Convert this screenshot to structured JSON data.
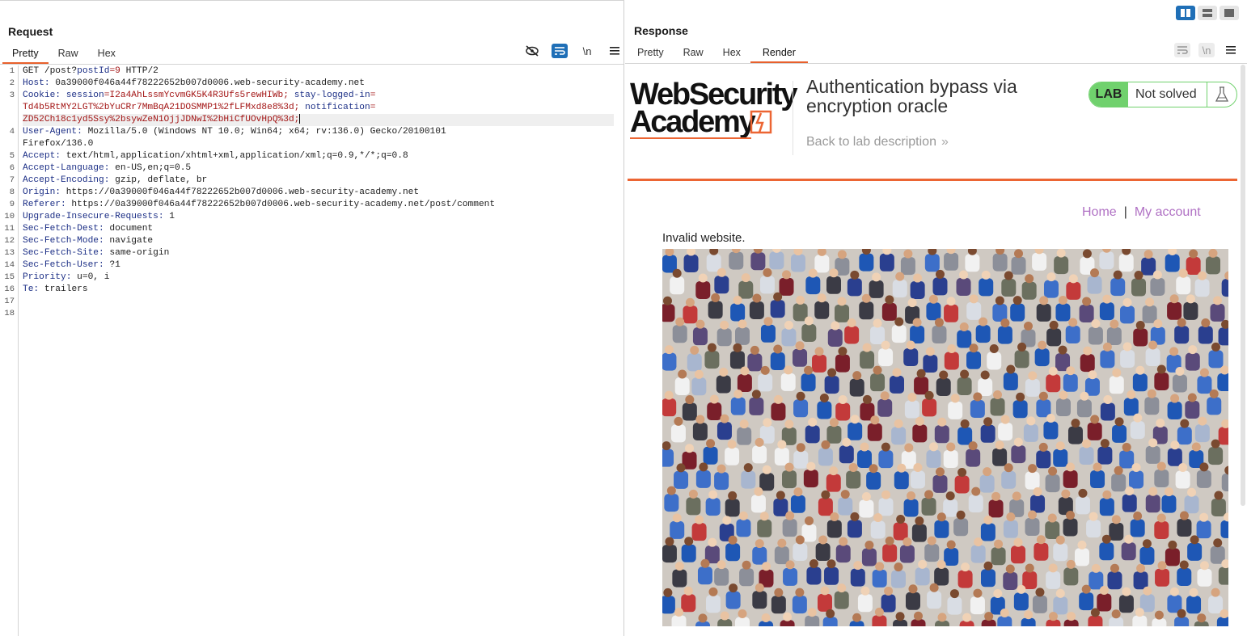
{
  "layout": {
    "buttons": [
      "split-horizontal",
      "split-vertical",
      "tabbed"
    ],
    "active": "split-horizontal"
  },
  "request": {
    "title": "Request",
    "tabs": [
      "Pretty",
      "Raw",
      "Hex"
    ],
    "active_tab": "Pretty",
    "tools": {
      "hide_icon": "eye-slash-icon",
      "wrap_icon": "word-wrap-icon",
      "newline_label": "\\n",
      "menu_icon": "hamburger-menu-icon"
    },
    "line_numbers": [
      "1",
      "2",
      "3",
      "",
      "",
      "4",
      "",
      "5",
      "6",
      "7",
      "8",
      "9",
      "10",
      "11",
      "12",
      "13",
      "14",
      "15",
      "16",
      "17",
      "18"
    ],
    "lines": {
      "l1_a": "GET /post?",
      "l1_param": "postId",
      "l1_eq": "=",
      "l1_val": "9",
      "l1_b": " HTTP/2",
      "l2_key": "Host:",
      "l2_val": " 0a39000f046a44f78222652b007d0006.web-security-academy.net",
      "l3_key": "Cookie:",
      "l3_c1k": " session",
      "l3_c1v": "=I2a4AhLssmYcvmGK5K4R3Ufs5rewHIWb;",
      "l3_c2k": " stay-logged-in",
      "l3_c2e": "=",
      "l3b_val": "Td4b5RtMY2LGT%2bYuCRr7MmBqA21DOSMMP1%2fLFMxd8e8%3d;",
      "l3b_k": " notification",
      "l3b_e": "=",
      "l3c_val": "ZD52Ch18c1yd5Ssy%2bsywZeN1OjjJDNwI%2bHiCfUOvHpQ%3d;",
      "l4_key": "User-Agent:",
      "l4_val": " Mozilla/5.0 (Windows NT 10.0; Win64; x64; rv:136.0) Gecko/20100101",
      "l4b_val": "Firefox/136.0",
      "l5_key": "Accept:",
      "l5_val": " text/html,application/xhtml+xml,application/xml;q=0.9,*/*;q=0.8",
      "l6_key": "Accept-Language:",
      "l6_val": " en-US,en;q=0.5",
      "l7_key": "Accept-Encoding:",
      "l7_val": " gzip, deflate, br",
      "l8_key": "Origin:",
      "l8_val": " https://0a39000f046a44f78222652b007d0006.web-security-academy.net",
      "l9_key": "Referer:",
      "l9_val": " https://0a39000f046a44f78222652b007d0006.web-security-academy.net/post/comment",
      "l10_key": "Upgrade-Insecure-Requests:",
      "l10_val": " 1",
      "l11_key": "Sec-Fetch-Dest:",
      "l11_val": " document",
      "l12_key": "Sec-Fetch-Mode:",
      "l12_val": " navigate",
      "l13_key": "Sec-Fetch-Site:",
      "l13_val": " same-origin",
      "l14_key": "Sec-Fetch-User:",
      "l14_val": " ?1",
      "l15_key": "Priority:",
      "l15_val": " u=0, i",
      "l16_key": "Te:",
      "l16_val": " trailers"
    }
  },
  "response": {
    "title": "Response",
    "tabs": [
      "Pretty",
      "Raw",
      "Hex",
      "Render"
    ],
    "active_tab": "Render",
    "tools": {
      "wrap_icon": "word-wrap-icon",
      "newline_label": "\\n",
      "menu_icon": "hamburger-menu-icon"
    },
    "render": {
      "logo_line1": "WebSecurity",
      "logo_line2": "Academy",
      "lab_title": "Authentication bypass via encryption oracle",
      "back_link": "Back to lab description",
      "back_chevron": "»",
      "badge_label": "LAB",
      "badge_status": "Not solved",
      "badge_icon": "flask-icon",
      "nav_home": "Home",
      "nav_sep": "|",
      "nav_account": "My account",
      "message": "Invalid website.",
      "image": "crowd-of-people-image"
    },
    "colors": {
      "accent_orange": "#ec6533",
      "lab_green": "#70d16d",
      "link_purple": "#b071c4",
      "burp_blue": "#1f6fb7"
    }
  }
}
